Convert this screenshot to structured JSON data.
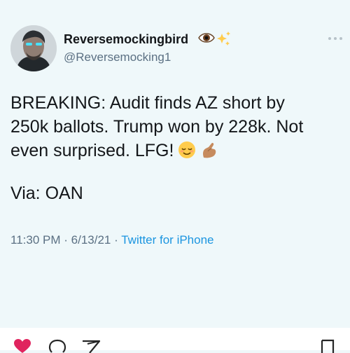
{
  "tweet": {
    "display_name": "Reversemockingbird",
    "name_emojis": [
      "eye-emoji",
      "sparkles-emoji"
    ],
    "handle": "@Reversemocking1",
    "text_lines": [
      "BREAKING: Audit finds AZ short by",
      "250k ballots. Trump won by 228k. Not",
      "even surprised. LFG!"
    ],
    "text_emojis": [
      "relieved-face-emoji",
      "pinching-hand-emoji"
    ],
    "via": "Via: OAN",
    "time": "11:30 PM",
    "date": "6/13/21",
    "separator": "·",
    "source": "Twitter for iPhone"
  },
  "colors": {
    "background": "#eff8fa",
    "text": "#14171a",
    "secondary": "#5b7083",
    "link": "#1b95e0",
    "like": "#e0245e"
  },
  "action_bar": {
    "icons": [
      "heart-icon",
      "comment-icon",
      "share-icon",
      "bookmark-icon"
    ]
  }
}
